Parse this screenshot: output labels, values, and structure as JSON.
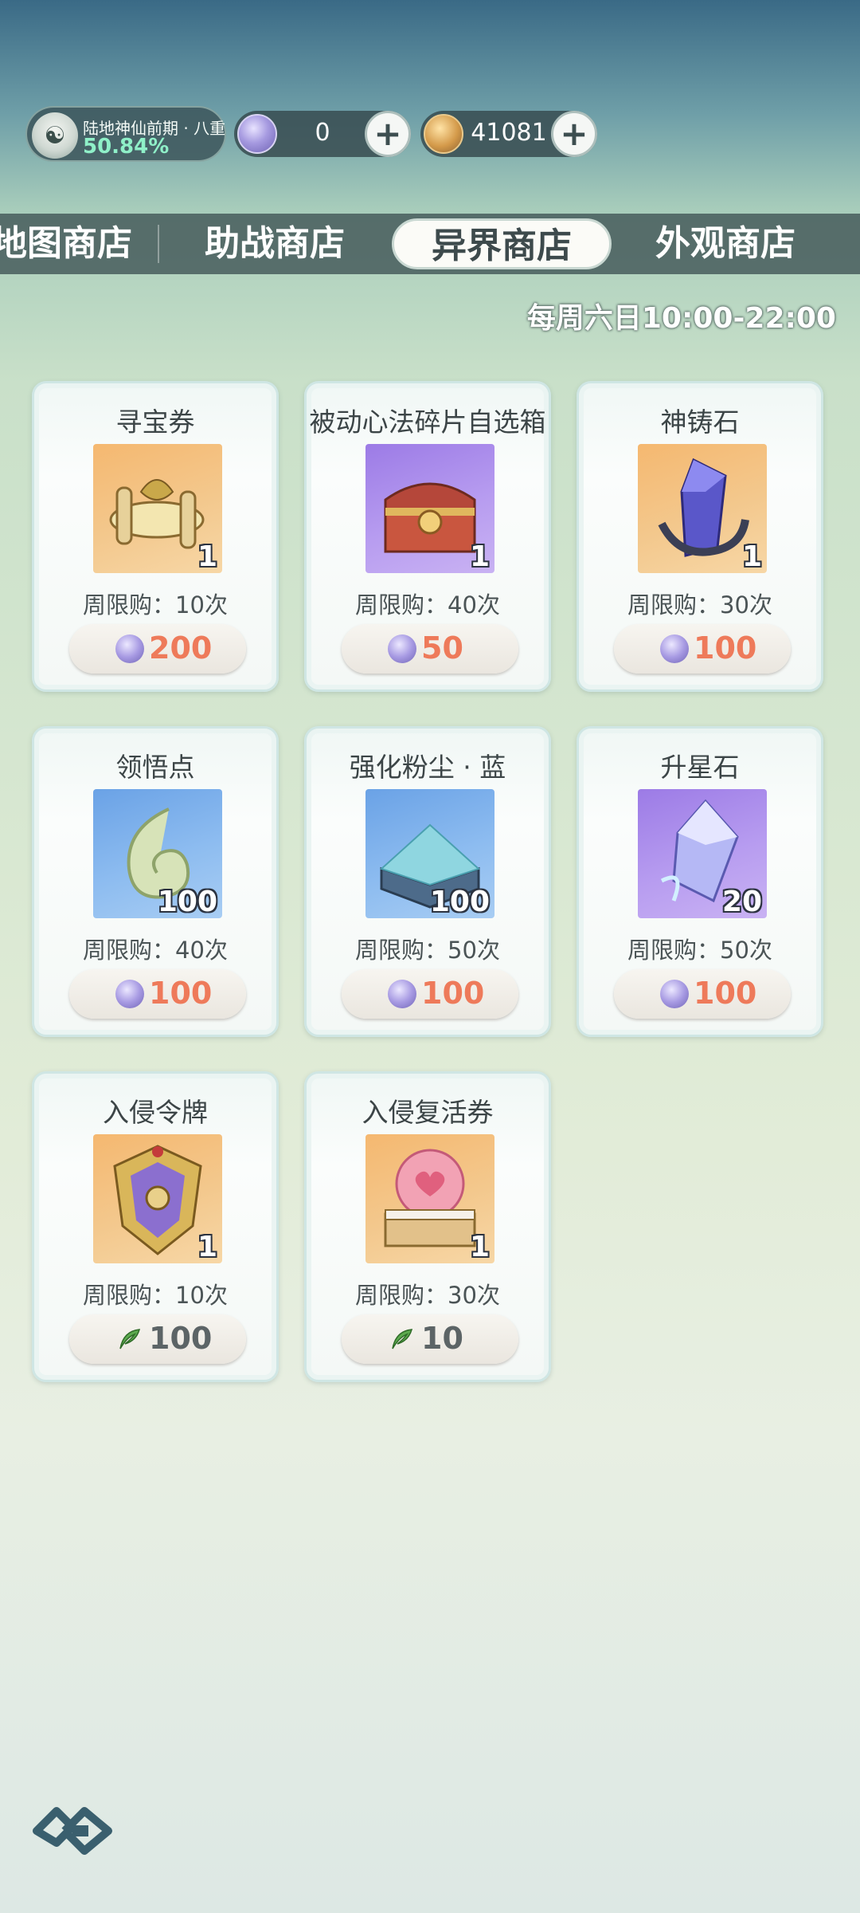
{
  "status": {
    "realm_name": "陆地神仙前期 · 八重",
    "realm_progress": "50.84%",
    "currency_crystal": "0",
    "currency_leaf": "41081"
  },
  "tabs": [
    {
      "label": "地图商店"
    },
    {
      "label": "助战商店"
    },
    {
      "label": "异界商店",
      "active": true
    },
    {
      "label": "外观商店"
    }
  ],
  "schedule": "每周六日10:00-22:00",
  "items": [
    {
      "name": "寻宝券",
      "qty": "1",
      "limit": "周限购：10次",
      "price": "200",
      "currency": "crystal-coin-icon",
      "bg": "orange",
      "icon": "treasure-scroll-icon"
    },
    {
      "name": "被动心法碎片自选箱",
      "qty": "1",
      "limit": "周限购：40次",
      "price": "50",
      "currency": "crystal-coin-icon",
      "bg": "purple",
      "icon": "treasure-chest-icon"
    },
    {
      "name": "神铸石",
      "qty": "1",
      "limit": "周限购：30次",
      "price": "100",
      "currency": "crystal-coin-icon",
      "bg": "orange",
      "icon": "forge-crystal-icon"
    },
    {
      "name": "领悟点",
      "qty": "100",
      "limit": "周限购：40次",
      "price": "100",
      "currency": "crystal-coin-icon",
      "bg": "blue",
      "icon": "jade-swirl-icon"
    },
    {
      "name": "强化粉尘 · 蓝",
      "qty": "100",
      "limit": "周限购：50次",
      "price": "100",
      "currency": "crystal-coin-icon",
      "bg": "blue",
      "icon": "dust-box-icon"
    },
    {
      "name": "升星石",
      "qty": "20",
      "limit": "周限购：50次",
      "price": "100",
      "currency": "crystal-coin-icon",
      "bg": "purple",
      "icon": "star-crystal-icon"
    },
    {
      "name": "入侵令牌",
      "qty": "1",
      "limit": "周限购：10次",
      "price": "100",
      "currency": "leaf-coin-icon",
      "bg": "orange",
      "icon": "invasion-token-icon"
    },
    {
      "name": "入侵复活券",
      "qty": "1",
      "limit": "周限购：30次",
      "price": "10",
      "currency": "leaf-coin-icon",
      "bg": "orange",
      "icon": "heart-orb-icon"
    }
  ],
  "colors": {
    "accent_price": "#ee7a5a",
    "tab_bar": "#465c5c",
    "active_tab_bg": "#fbfbf7"
  }
}
